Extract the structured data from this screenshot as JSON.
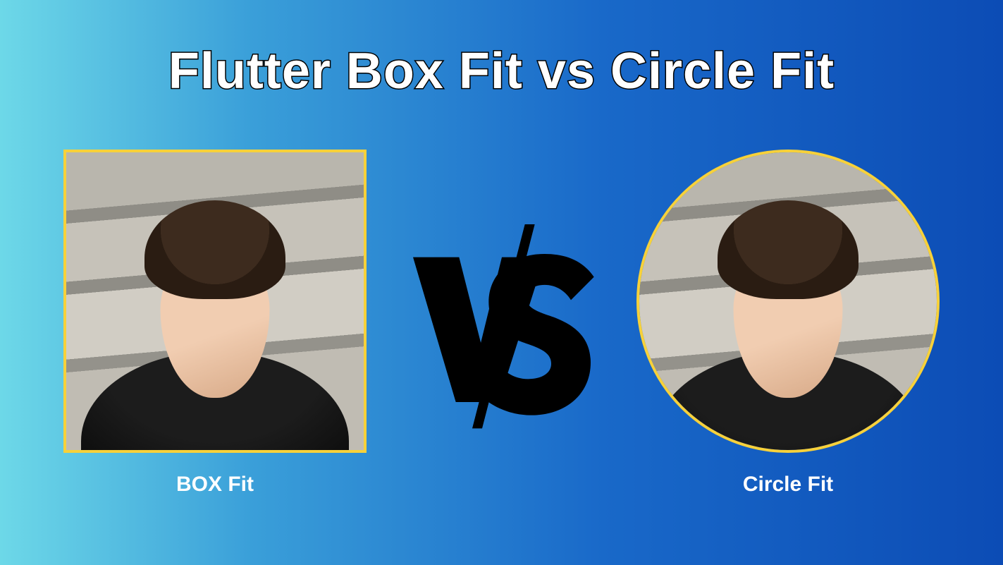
{
  "title": "Flutter Box Fit vs Circle Fit",
  "left": {
    "caption": "BOX Fit"
  },
  "right": {
    "caption": "Circle Fit"
  },
  "separator": {
    "label": "VS"
  },
  "style": {
    "border_color": "#f7d13a"
  }
}
